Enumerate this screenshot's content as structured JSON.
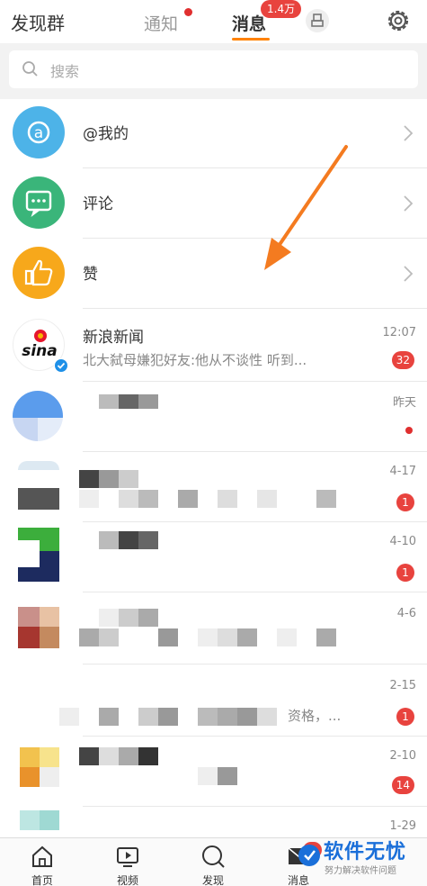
{
  "header": {
    "left_title": "发现群",
    "tab_notify": "通知",
    "tab_messages": "消息",
    "messages_badge": "1.4万",
    "accent_color": "#ff8200"
  },
  "search": {
    "placeholder": "搜索"
  },
  "fixed_items": [
    {
      "label": "@我的",
      "icon": "at-icon",
      "color": "#4db3e8"
    },
    {
      "label": "评论",
      "icon": "comment-icon",
      "color": "#3ab57a"
    },
    {
      "label": "赞",
      "icon": "thumbs-up-icon",
      "color": "#f7a81b"
    }
  ],
  "conversations": [
    {
      "name": "新浪新闻",
      "preview": "北大弑母嫌犯好友:他从不谈性 听到...",
      "time": "12:07",
      "count": "32"
    },
    {
      "time": "昨天"
    },
    {
      "time": "4-17",
      "count": "1"
    },
    {
      "time": "4-10",
      "count": "1"
    },
    {
      "time": "4-6"
    },
    {
      "preview_tail": "资格，...",
      "time": "2-15",
      "count": "1"
    },
    {
      "time": "2-10",
      "count": "14"
    },
    {
      "time": "1-29"
    }
  ],
  "bottom_nav": [
    {
      "label": "首页",
      "icon": "home-icon"
    },
    {
      "label": "视频",
      "icon": "video-icon"
    },
    {
      "label": "发现",
      "icon": "discover-icon"
    },
    {
      "label": "消息",
      "icon": "message-icon"
    }
  ],
  "bottom_badge": "1.",
  "watermark": {
    "title": "软件无忧",
    "subtitle": "努力解决软件问题"
  }
}
